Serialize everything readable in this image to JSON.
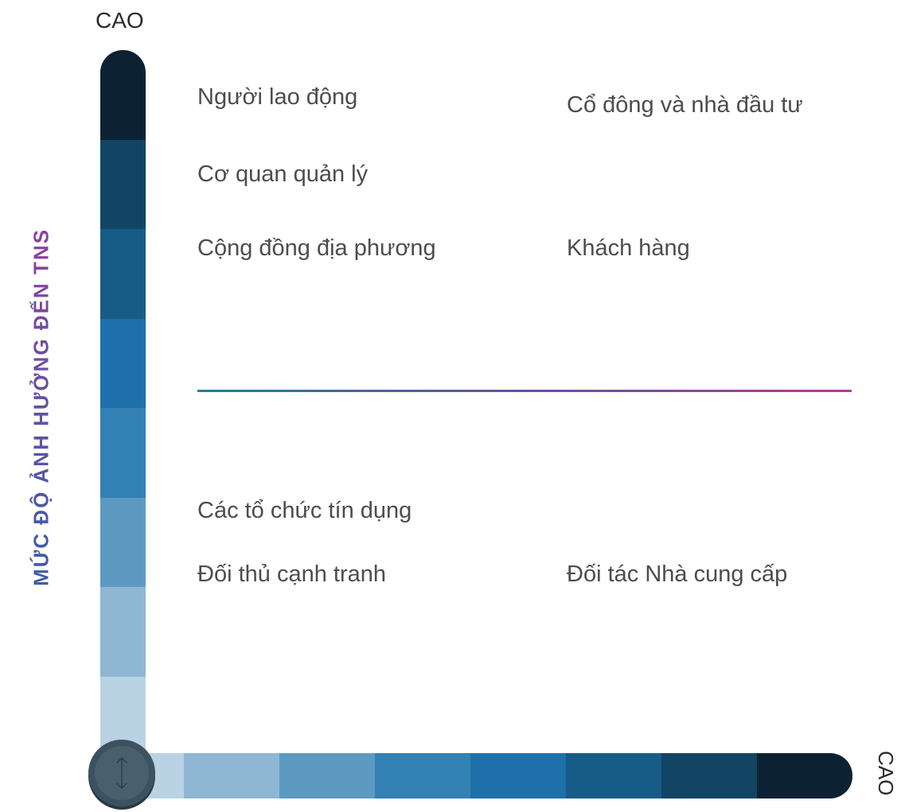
{
  "axes": {
    "top_label": "CAO",
    "right_label": "CAO",
    "y_title": "MỨC ĐỘ ẢNH HƯỞNG ĐẾN TNS"
  },
  "stakeholders": {
    "nguoi_lao_dong": "Người lao động",
    "co_dong": "Cổ đông và nhà đầu tư",
    "co_quan_quan_ly": "Cơ quan quản lý",
    "cong_dong": "Cộng đồng địa phương",
    "khach_hang": "Khách hàng",
    "to_chuc_tin_dung": "Các tổ chức tín dụng",
    "doi_thu": "Đối thủ cạnh tranh",
    "doi_tac": "Đối tác Nhà cung cấp"
  },
  "colors": {
    "bar_gradient": [
      "#0c2233",
      "#124563",
      "#175b87",
      "#1d70a9",
      "#3380b4",
      "#5c9ac2",
      "#8fb7d3",
      "#b9d3e4"
    ],
    "divider_start": "#1e7f9e",
    "divider_end": "#b03b9c"
  }
}
